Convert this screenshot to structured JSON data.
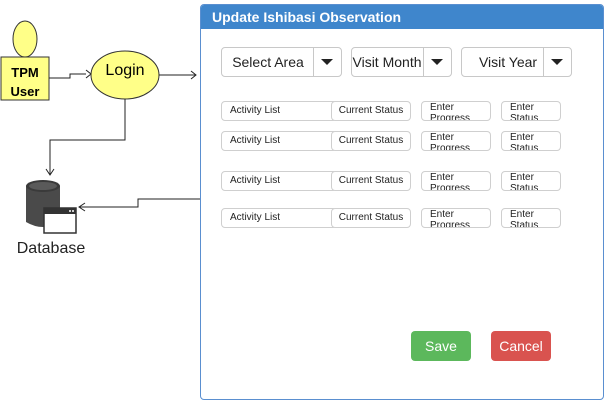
{
  "diagram": {
    "actor": {
      "line1": "TPM",
      "line2": "User"
    },
    "login": "Login",
    "database": "Database"
  },
  "panel": {
    "title": "Update Ishibasi Observation",
    "dropdowns": {
      "area": "Select Area",
      "month": "Visit Month",
      "year": "Visit Year"
    },
    "rows": [
      {
        "activity": "Activity List",
        "status": "Current Status",
        "progress": "Enter Progress",
        "status_input": "Enter Status"
      },
      {
        "activity": "Activity List",
        "status": "Current Status",
        "progress": "Enter Progress",
        "status_input": "Enter Status"
      },
      {
        "activity": "Activity List",
        "status": "Current Status",
        "progress": "Enter Progress",
        "status_input": "Enter Status"
      },
      {
        "activity": "Activity List",
        "status": "Current Status",
        "progress": "Enter Progress",
        "status_input": "Enter Status"
      }
    ],
    "buttons": {
      "save": "Save",
      "cancel": "Cancel"
    }
  },
  "colors": {
    "header": "#3f86cc",
    "actor_fill": "#ffff88",
    "save": "#5cb85c",
    "cancel": "#d9534f"
  }
}
